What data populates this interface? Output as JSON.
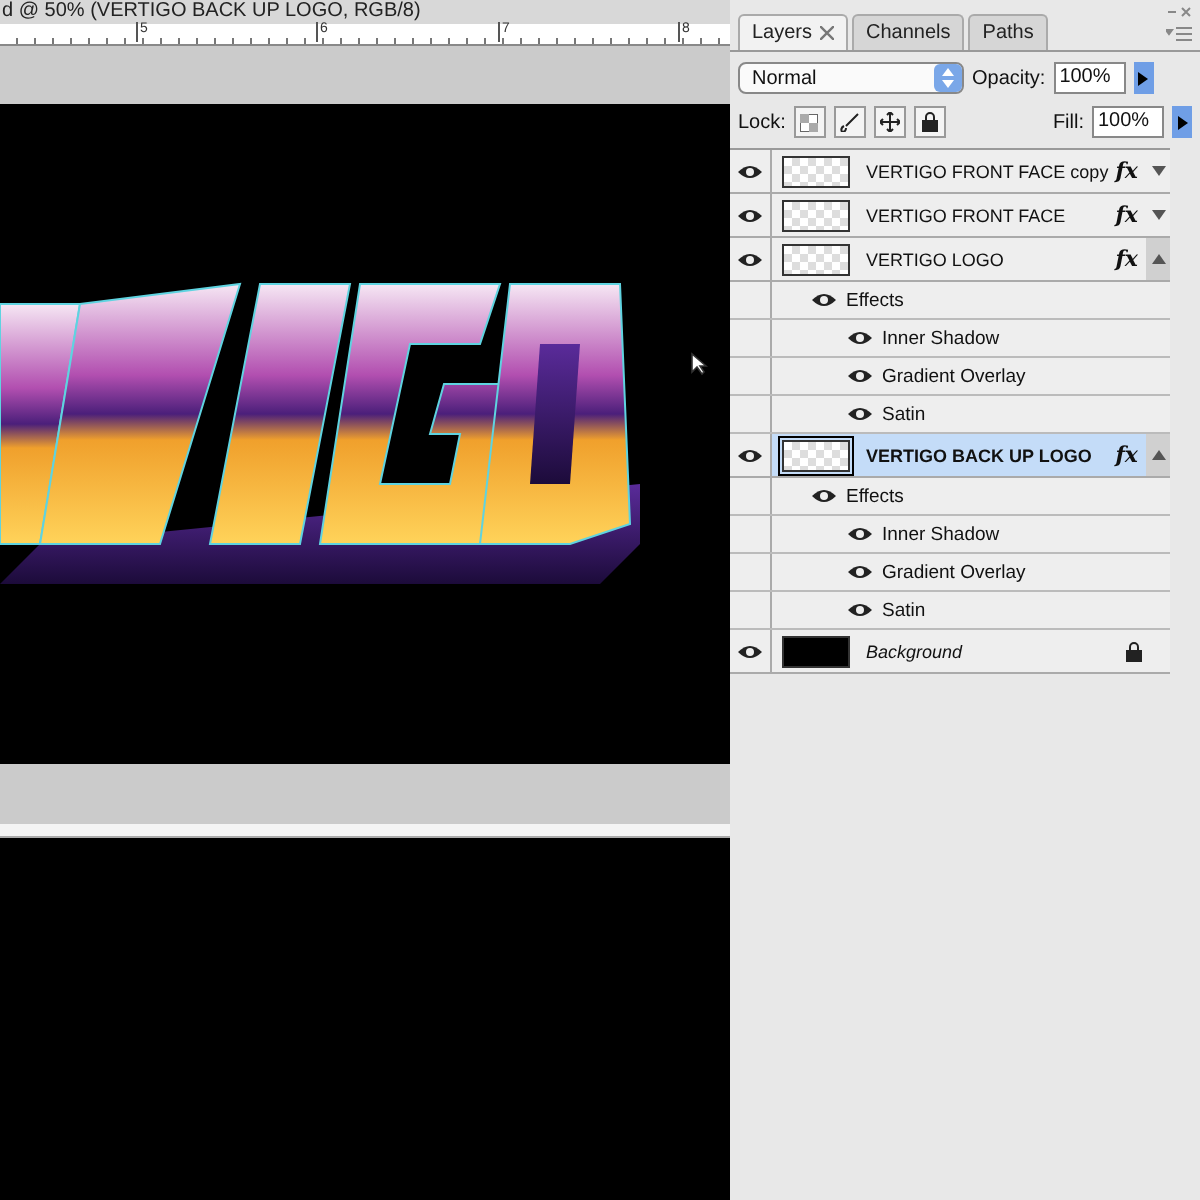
{
  "document": {
    "title": "d @ 50% (VERTIGO BACK UP LOGO, RGB/8)",
    "ruler_labels": [
      "5",
      "6",
      "7",
      "8"
    ]
  },
  "panel": {
    "tabs": [
      {
        "label": "Layers",
        "selected": true,
        "closable": true
      },
      {
        "label": "Channels",
        "selected": false,
        "closable": false
      },
      {
        "label": "Paths",
        "selected": false,
        "closable": false
      }
    ],
    "blend_mode": "Normal",
    "opacity_label": "Opacity:",
    "opacity": "100%",
    "lock_label": "Lock:",
    "fill_label": "Fill:",
    "fill": "100%"
  },
  "layers": [
    {
      "name": "VERTIGO FRONT FACE copy",
      "kind": "layer",
      "visible": true,
      "selected": false,
      "fx_label": "fx",
      "locked": false,
      "expanded": false
    },
    {
      "name": "VERTIGO FRONT FACE",
      "kind": "layer",
      "visible": true,
      "selected": false,
      "fx_label": "fx",
      "locked": false,
      "expanded": false
    },
    {
      "name": "VERTIGO LOGO",
      "kind": "layer",
      "visible": true,
      "selected": false,
      "fx_label": "fx",
      "locked": false,
      "expanded": true,
      "effects": {
        "label": "Effects",
        "visible": true,
        "items": [
          {
            "name": "Inner Shadow",
            "visible": true
          },
          {
            "name": "Gradient Overlay",
            "visible": true
          },
          {
            "name": "Satin",
            "visible": true
          }
        ]
      }
    },
    {
      "name": "VERTIGO BACK UP LOGO",
      "kind": "layer",
      "visible": true,
      "selected": true,
      "fx_label": "fx",
      "locked": false,
      "expanded": true,
      "effects": {
        "label": "Effects",
        "visible": true,
        "items": [
          {
            "name": "Inner Shadow",
            "visible": true
          },
          {
            "name": "Gradient Overlay",
            "visible": true
          },
          {
            "name": "Satin",
            "visible": true
          }
        ]
      }
    },
    {
      "name": "Background",
      "kind": "background",
      "visible": true,
      "selected": false,
      "locked": true
    }
  ]
}
